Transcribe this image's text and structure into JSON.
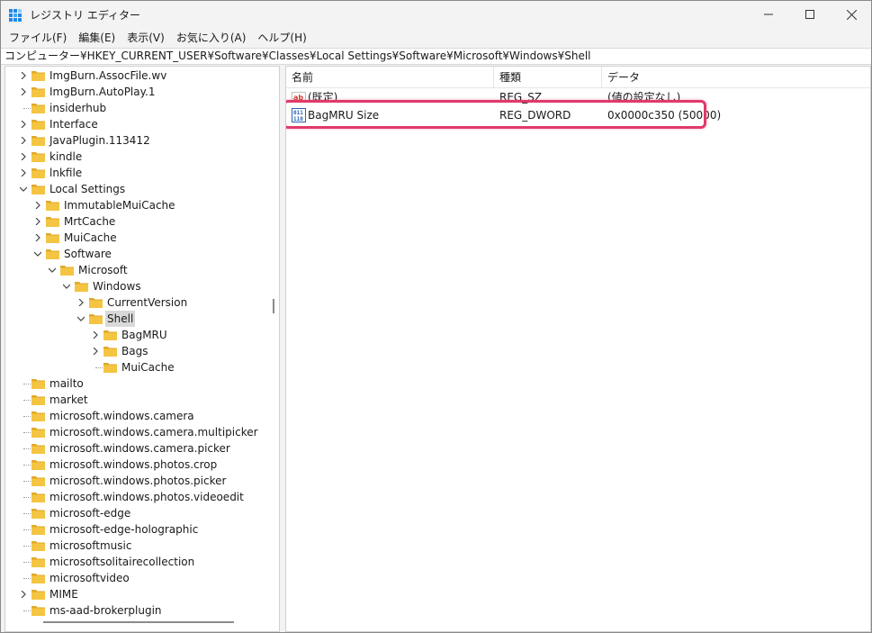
{
  "window": {
    "title": "レジストリ エディター",
    "minimize_glyph": "—",
    "maximize_glyph": "☐",
    "close_glyph": "✕"
  },
  "menu": [
    "ファイル(F)",
    "編集(E)",
    "表示(V)",
    "お気に入り(A)",
    "ヘルプ(H)"
  ],
  "address": "コンピューター¥HKEY_CURRENT_USER¥Software¥Classes¥Local Settings¥Software¥Microsoft¥Windows¥Shell",
  "tree": [
    {
      "label": "ImgBurn.AssocFile.wv",
      "depth": 0,
      "expander": "collapsed"
    },
    {
      "label": "ImgBurn.AutoPlay.1",
      "depth": 0,
      "expander": "collapsed"
    },
    {
      "label": "insiderhub",
      "depth": 0,
      "expander": "none"
    },
    {
      "label": "Interface",
      "depth": 0,
      "expander": "collapsed"
    },
    {
      "label": "JavaPlugin.113412",
      "depth": 0,
      "expander": "collapsed"
    },
    {
      "label": "kindle",
      "depth": 0,
      "expander": "collapsed"
    },
    {
      "label": "lnkfile",
      "depth": 0,
      "expander": "collapsed"
    },
    {
      "label": "Local Settings",
      "depth": 0,
      "expander": "expanded"
    },
    {
      "label": "ImmutableMuiCache",
      "depth": 1,
      "expander": "collapsed"
    },
    {
      "label": "MrtCache",
      "depth": 1,
      "expander": "collapsed"
    },
    {
      "label": "MuiCache",
      "depth": 1,
      "expander": "collapsed"
    },
    {
      "label": "Software",
      "depth": 1,
      "expander": "expanded"
    },
    {
      "label": "Microsoft",
      "depth": 2,
      "expander": "expanded"
    },
    {
      "label": "Windows",
      "depth": 3,
      "expander": "expanded"
    },
    {
      "label": "CurrentVersion",
      "depth": 4,
      "expander": "collapsed"
    },
    {
      "label": "Shell",
      "depth": 4,
      "expander": "expanded",
      "selected": true
    },
    {
      "label": "BagMRU",
      "depth": 5,
      "expander": "collapsed"
    },
    {
      "label": "Bags",
      "depth": 5,
      "expander": "collapsed"
    },
    {
      "label": "MuiCache",
      "depth": 5,
      "expander": "none"
    },
    {
      "label": "mailto",
      "depth": 0,
      "expander": "none"
    },
    {
      "label": "market",
      "depth": 0,
      "expander": "none"
    },
    {
      "label": "microsoft.windows.camera",
      "depth": 0,
      "expander": "none"
    },
    {
      "label": "microsoft.windows.camera.multipicker",
      "depth": 0,
      "expander": "none"
    },
    {
      "label": "microsoft.windows.camera.picker",
      "depth": 0,
      "expander": "none"
    },
    {
      "label": "microsoft.windows.photos.crop",
      "depth": 0,
      "expander": "none"
    },
    {
      "label": "microsoft.windows.photos.picker",
      "depth": 0,
      "expander": "none"
    },
    {
      "label": "microsoft.windows.photos.videoedit",
      "depth": 0,
      "expander": "none"
    },
    {
      "label": "microsoft-edge",
      "depth": 0,
      "expander": "none"
    },
    {
      "label": "microsoft-edge-holographic",
      "depth": 0,
      "expander": "none"
    },
    {
      "label": "microsoftmusic",
      "depth": 0,
      "expander": "none"
    },
    {
      "label": "microsoftsolitairecollection",
      "depth": 0,
      "expander": "none"
    },
    {
      "label": "microsoftvideo",
      "depth": 0,
      "expander": "none"
    },
    {
      "label": "MIME",
      "depth": 0,
      "expander": "collapsed"
    },
    {
      "label": "ms-aad-brokerplugin",
      "depth": 0,
      "expander": "none"
    }
  ],
  "list": {
    "columns": [
      "名前",
      "種類",
      "データ"
    ],
    "rows": [
      {
        "name": "(既定)",
        "type": "REG_SZ",
        "data": "(値の設定なし)",
        "icon": "string-value-icon"
      },
      {
        "name": "BagMRU Size",
        "type": "REG_DWORD",
        "data": "0x0000c350 (50000)",
        "icon": "dword-value-icon",
        "highlighted": true
      }
    ]
  },
  "colors": {
    "highlight": "#e03a6a",
    "folder": "#f4c542",
    "selection": "#d9d9d9"
  }
}
